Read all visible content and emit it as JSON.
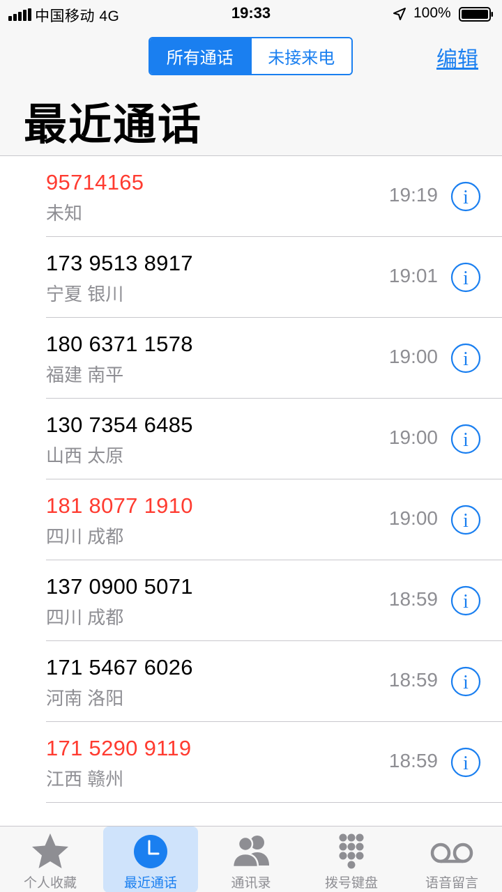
{
  "status_bar": {
    "carrier": "中国移动 4G",
    "time": "19:33",
    "battery": "100%"
  },
  "header": {
    "segments": [
      "所有通话",
      "未接来电"
    ],
    "active_segment": 0,
    "edit_label": "编辑",
    "title": "最近通话"
  },
  "calls": [
    {
      "number": "95714165",
      "location": "未知",
      "time": "19:19",
      "missed": true
    },
    {
      "number": "173 9513 8917",
      "location": "宁夏 银川",
      "time": "19:01",
      "missed": false
    },
    {
      "number": "180 6371 1578",
      "location": "福建 南平",
      "time": "19:00",
      "missed": false
    },
    {
      "number": "130 7354 6485",
      "location": "山西 太原",
      "time": "19:00",
      "missed": false
    },
    {
      "number": "181 8077 1910",
      "location": "四川 成都",
      "time": "19:00",
      "missed": true
    },
    {
      "number": "137 0900 5071",
      "location": "四川 成都",
      "time": "18:59",
      "missed": false
    },
    {
      "number": "171 5467 6026",
      "location": "河南 洛阳",
      "time": "18:59",
      "missed": false
    },
    {
      "number": "171 5290 9119",
      "location": "江西 赣州",
      "time": "18:59",
      "missed": true
    }
  ],
  "tabs": [
    {
      "label": "个人收藏",
      "icon": "star-icon"
    },
    {
      "label": "最近通话",
      "icon": "clock-icon"
    },
    {
      "label": "通讯录",
      "icon": "contacts-icon"
    },
    {
      "label": "拨号键盘",
      "icon": "keypad-icon"
    },
    {
      "label": "语音留言",
      "icon": "voicemail-icon"
    }
  ],
  "active_tab": 1,
  "colors": {
    "accent": "#1a7ff0",
    "missed": "#ff3b30",
    "secondary_text": "#8e8e93",
    "bar_background": "#f7f7f7"
  }
}
